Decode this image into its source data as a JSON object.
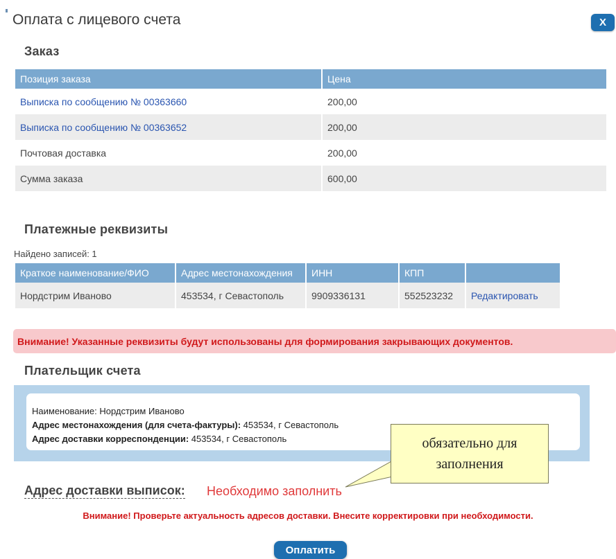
{
  "modal": {
    "title": "Оплата с лицевого счета",
    "close_label": "X"
  },
  "order": {
    "section_title": "Заказ",
    "columns": [
      "Позиция заказа",
      "Цена"
    ],
    "rows": [
      {
        "item": "Выписка по сообщению № 00363660",
        "price": "200,00",
        "link": true
      },
      {
        "item": "Выписка по сообщению № 00363652",
        "price": "200,00",
        "link": true
      },
      {
        "item": "Почтовая доставка",
        "price": "200,00",
        "link": false
      },
      {
        "item": "Сумма заказа",
        "price": "600,00",
        "link": false
      }
    ]
  },
  "requisites": {
    "section_title": "Платежные реквизиты",
    "found_text": "Найдено записей: 1",
    "columns": [
      "Краткое наименование/ФИО",
      "Адрес местонахождения",
      "ИНН",
      "КПП",
      ""
    ],
    "rows": [
      {
        "name": "Нордстрим Иваново",
        "address": "453534, г Севастополь",
        "inn": "9909336131",
        "kpp": "552523232",
        "action": "Редактировать"
      }
    ]
  },
  "warning_requisites": "Внимание! Указанные реквизиты будут использованы для формирования закрывающих документов.",
  "payer": {
    "section_title": "Плательщик счета",
    "name_line": "Наименование: Нордстрим Иваново",
    "legal_label": "Адрес местонахождения (для счета-фактуры):",
    "legal_value": " 453534, г Севастополь",
    "delivery_label": "Адрес доставки корреспонденции:",
    "delivery_value": " 453534, г Севастополь"
  },
  "statement_address": {
    "label": "Адрес доставки выписок:",
    "value": "Необходимо заполнить"
  },
  "tooltip": {
    "line1": "обязательно для",
    "line2": "заполнения"
  },
  "warning_addresses": "Внимание! Проверьте актуальность адресов доставки. Внесите корректировки при необходимости.",
  "pay_button": "Оплатить",
  "colors": {
    "accent": "#1e6fb0",
    "header": "#7aa8cf",
    "warning": "#d0191b",
    "warning_bg": "#f8c9cc",
    "tooltip_bg": "#ffffc4"
  }
}
